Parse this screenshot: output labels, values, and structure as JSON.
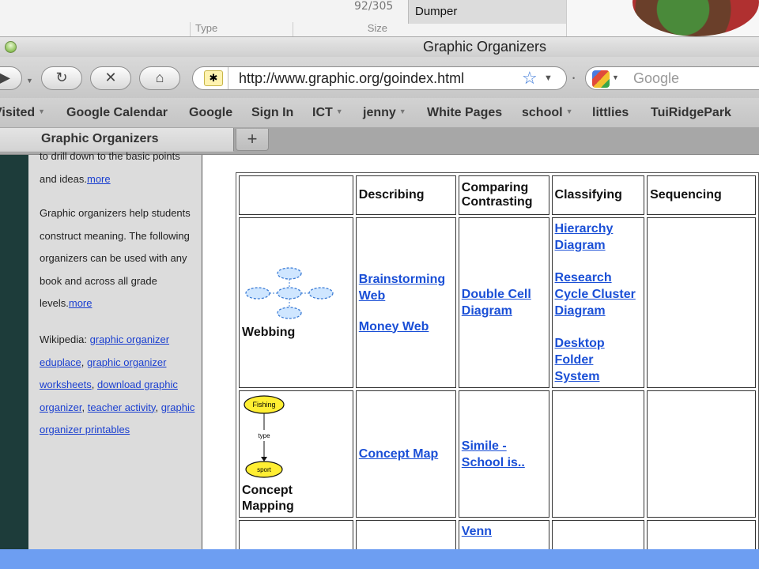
{
  "background": {
    "count": "92/305",
    "col_type": "Type",
    "col_size": "Size",
    "dumper": "Dumper"
  },
  "window": {
    "title": "Graphic Organizers"
  },
  "toolbar": {
    "url": "http://www.graphic.org/goindex.html",
    "search_placeholder": "Google",
    "back_icon": "back-arrow-icon",
    "reload_icon": "reload-icon",
    "stop_icon": "stop-icon",
    "home_icon": "home-icon"
  },
  "bookmarks": [
    "Visited",
    "Google Calendar",
    "Google",
    "Sign In",
    "ICT",
    "jenny",
    "White Pages",
    "school",
    "littlies",
    "TuiRidgePark"
  ],
  "tabs": [
    {
      "label": "Graphic Organizers"
    }
  ],
  "newtab_label": "+",
  "sidebar": {
    "p1_text": "to drill down to the basic points and ideas.",
    "p1_link": "more",
    "p2_text": "Graphic organizers help students construct meaning. The following organizers can be used with any book and across all grade levels.",
    "p2_link": "more",
    "p3_prefix": "Wikipedia: ",
    "links": [
      "graphic organizer",
      "eduplace",
      "graphic organizer worksheets",
      "download graphic organizer",
      "teacher activity",
      "graphic organizer printables"
    ]
  },
  "table": {
    "headers": [
      "",
      "Describing",
      "Comparing Contrasting",
      "Classifying",
      "Sequencing"
    ],
    "rows": [
      {
        "label": "Webbing",
        "describing": [
          "Brainstorming Web",
          "Money Web"
        ],
        "comparing": [
          "Double Cell Diagram"
        ],
        "classifying": [
          "Hierarchy Diagram",
          "Research Cycle Cluster Diagram",
          "Desktop Folder System"
        ]
      },
      {
        "label": "Concept Mapping",
        "diagram_top": "Fishing",
        "diagram_mid": "type",
        "diagram_bottom": "sport",
        "describing": [
          "Concept Map"
        ],
        "comparing": [
          "Simile - School is.."
        ]
      },
      {
        "comparing": [
          "Venn"
        ]
      }
    ]
  }
}
